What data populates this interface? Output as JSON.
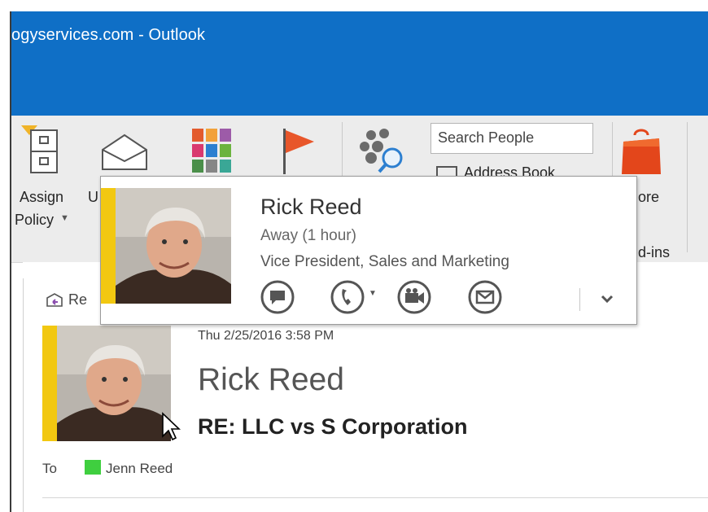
{
  "window": {
    "title": "ogyservices.com - Outlook"
  },
  "ribbon": {
    "assign_policy_line1": "Assign",
    "assign_policy_line2": "Policy",
    "unread_partial": "U",
    "search_people_placeholder": "Search People",
    "address_book_partial": "Address Book",
    "store_partial": "ore",
    "addins_partial": "d-ins"
  },
  "contact_card": {
    "name": "Rick Reed",
    "status": "Away (1 hour)",
    "job_title": "Vice President, Sales and Marketing"
  },
  "email": {
    "reply_partial": "Re",
    "date": "Thu 2/25/2016 3:58 PM",
    "sender": "Rick Reed",
    "subject": "RE: LLC vs S Corporation",
    "to_label": "To",
    "recipient": "Jenn Reed"
  },
  "colors": {
    "title_bar": "#0f6fc6",
    "presence_away": "#f2c811",
    "recipient_presence": "#3fcf3f",
    "flag": "#e8562a",
    "store_bag": "#e3461b"
  }
}
